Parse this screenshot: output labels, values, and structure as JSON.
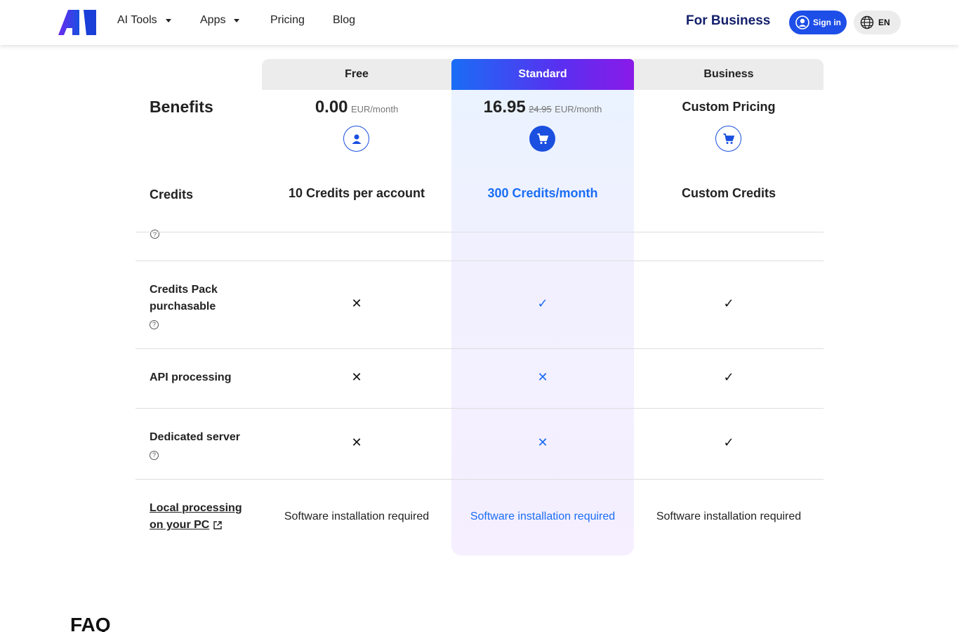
{
  "header": {
    "nav": [
      {
        "label": "AI Tools",
        "has_dropdown": true
      },
      {
        "label": "Apps",
        "has_dropdown": true
      },
      {
        "label": "Pricing",
        "has_dropdown": false
      },
      {
        "label": "Blog",
        "has_dropdown": false
      }
    ],
    "for_business": "For Business",
    "sign_in": "Sign in",
    "language": "EN"
  },
  "pricing": {
    "benefits_label": "Benefits",
    "plans": [
      {
        "name": "Free",
        "price": "0.00",
        "old_price": "",
        "unit": "EUR/month",
        "icon": "user-icon",
        "credits": "10 Credits per account"
      },
      {
        "name": "Standard",
        "price": "16.95",
        "old_price": "24.95",
        "unit": "EUR/month",
        "icon": "cart-icon",
        "credits": "300 Credits/month"
      },
      {
        "name": "Business",
        "price": "Custom Pricing",
        "old_price": "",
        "unit": "",
        "icon": "cart-icon",
        "credits": "Custom Credits"
      }
    ],
    "rows": [
      {
        "label": "Credits",
        "values": [
          "10 Credits per account",
          "300 Credits/month",
          "Custom Credits"
        ]
      },
      {
        "label_line1": "Credits Pack",
        "label_line2": "purchasable",
        "values": [
          "no",
          "yes",
          "yes"
        ]
      },
      {
        "label": "API processing",
        "values": [
          "no",
          "no",
          "yes"
        ]
      },
      {
        "label": "Dedicated server",
        "values": [
          "no",
          "no",
          "yes"
        ]
      },
      {
        "label_line1": "Local processing",
        "label_line2": "on your PC",
        "values": [
          "Software installation required",
          "Software installation required",
          "Software installation required"
        ]
      }
    ],
    "help_symbol": "?",
    "check_symbol": "✓",
    "cross_symbol": "✕"
  },
  "faq_title": "FAQ",
  "colors": {
    "accent": "#1a4fe0",
    "brand_dark": "#14206b",
    "standard_gradient_start": "#1a6df5",
    "standard_gradient_end": "#8a1ae8"
  }
}
